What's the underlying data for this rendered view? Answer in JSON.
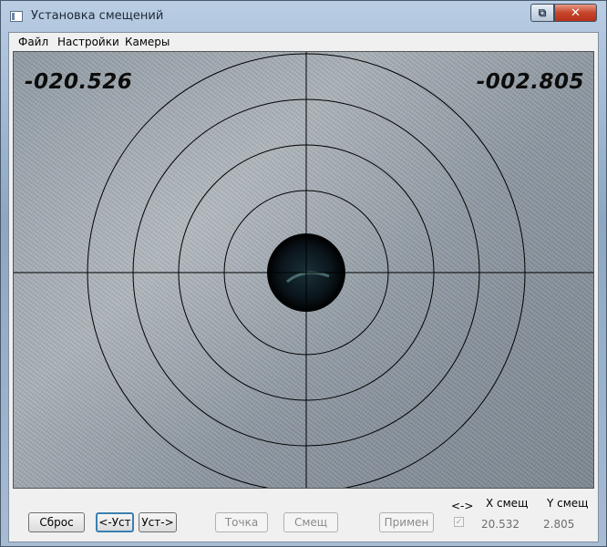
{
  "window": {
    "title": "Установка смещений",
    "restore_glyph": "⧉",
    "close_glyph": "✕"
  },
  "menu": {
    "items": [
      {
        "label": "Файл"
      },
      {
        "label": "Настройки"
      },
      {
        "label": "Камеры"
      }
    ]
  },
  "camera": {
    "readout_x": "-020.526",
    "readout_y": "-002.805"
  },
  "controls": {
    "reset_label": "Сброс",
    "set_left_label": "<-Уст",
    "set_right_label": "Уст->",
    "point_label": "Точка",
    "offset_label": "Смещ",
    "apply_label": "Примен",
    "swap_label": "<->",
    "swap_checked": true,
    "x_offset_header": "X смещ",
    "y_offset_header": "Y смещ",
    "x_offset_value": "20.532",
    "y_offset_value": "2.805"
  },
  "colors": {
    "active_border": "#3c7fb1",
    "close_button": "#c7442a"
  }
}
